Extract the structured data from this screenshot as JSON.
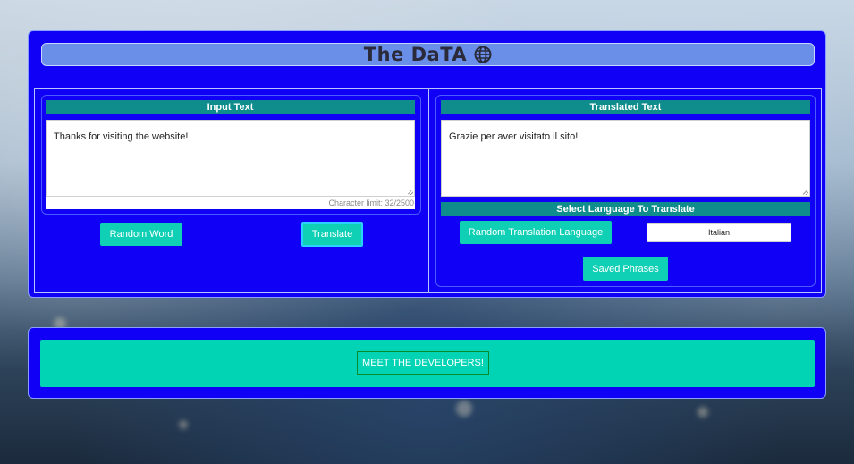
{
  "app": {
    "title": "The DaTA"
  },
  "input": {
    "header": "Input Text",
    "value": "Thanks for visiting the website!",
    "char_limit": "Character limit: 32/2500"
  },
  "output": {
    "header": "Translated Text",
    "value": "Grazie per aver visitato il sito!"
  },
  "language": {
    "header": "Select Language To Translate",
    "selected": "Italian"
  },
  "buttons": {
    "random_word": "Random Word",
    "translate": "Translate",
    "random_language": "Random Translation Language",
    "saved_phrases": "Saved Phrases",
    "meet_developers": "MEET THE DEVELOPERS!"
  },
  "colors": {
    "panel": "#1000f5",
    "title_bar": "#6a8fe8",
    "section_header": "#0f8c8c",
    "button": "#0fcfb4",
    "developer_band": "#00d4b4"
  },
  "icons": {
    "title": "globe-icon"
  }
}
